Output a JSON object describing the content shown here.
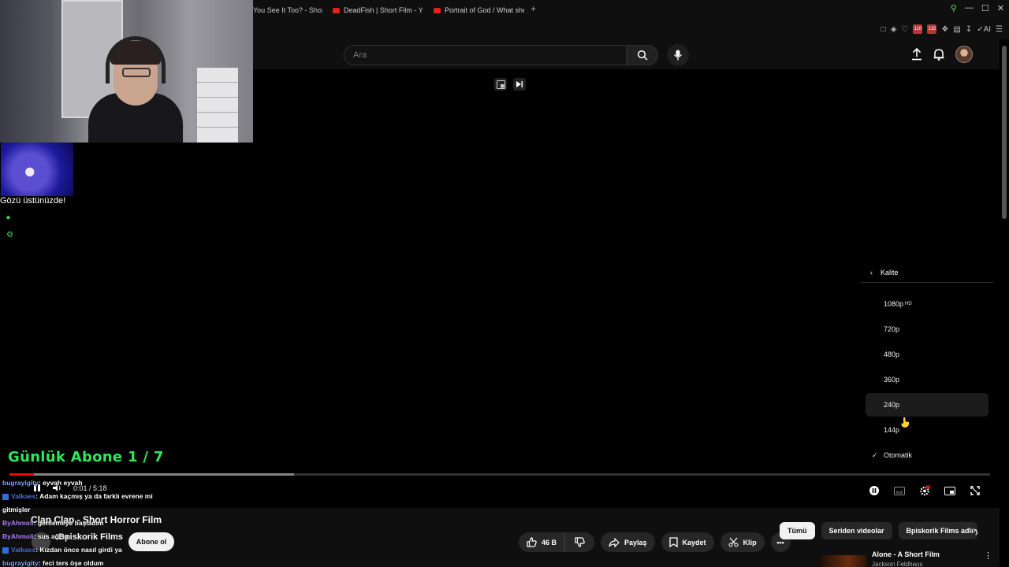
{
  "browser": {
    "tabs": [
      {
        "label": "You See It Too? - Shor"
      },
      {
        "label": "DeadFish | Short Film - Yo"
      },
      {
        "label": "Portrait of God / What she"
      }
    ],
    "toolbar_ai_label": "AI",
    "extension_badges": [
      "110",
      "115"
    ]
  },
  "search": {
    "placeholder": "Ara"
  },
  "overlay": {
    "alert_text": "Gözü üstünüzde!",
    "sub_goal": "Günlük Abone 1 / 7"
  },
  "quality_menu": {
    "title": "Kalite",
    "options": [
      {
        "label": "1080p",
        "badge": "HD"
      },
      {
        "label": "720p"
      },
      {
        "label": "480p"
      },
      {
        "label": "360p"
      },
      {
        "label": "240p"
      },
      {
        "label": "144p"
      },
      {
        "label": "Otomatik"
      }
    ],
    "checked": "Otomatik",
    "highlighted": "240p"
  },
  "player": {
    "time_current": "0:01",
    "time_sep": " / ",
    "time_total": "5:18",
    "progress_played_fraction": 0.0,
    "progress_buffered_fraction": 0.29
  },
  "chat": [
    {
      "user": "bugrayigity",
      "text": ": eyvah eyvah",
      "cls": "u1"
    },
    {
      "user": "Valkaes",
      "text": ": Adam kaçmış ya da farklı evrene mi",
      "cls": "u2",
      "badge": true
    },
    {
      "user": "",
      "text": "gitmişler",
      "cls": ""
    },
    {
      "user": "ByAhmoli",
      "text": ": gerilemeye başladım",
      "cls": "u3"
    },
    {
      "user": "ByAhmoli",
      "text": ": sus ağzım",
      "cls": "u3"
    },
    {
      "user": "Valkaes",
      "text": ": Kızdan önce nasıl girdi ya",
      "cls": "u2",
      "badge": true
    },
    {
      "user": "bugrayigity",
      "text": ": feci ters öşe oldum",
      "cls": "u1"
    }
  ],
  "video": {
    "title": "Clap Clap - Short Horror Film",
    "channel": "Bpiskorik Films",
    "subscribe_label": "Abone ol",
    "likes": "46 B",
    "share_label": "Paylaş",
    "save_label": "Kaydet",
    "clip_label": "Klip"
  },
  "chips": [
    {
      "label": "Tümü",
      "active": true
    },
    {
      "label": "Seriden videolar"
    },
    {
      "label": "Bpiskorik Films adlı y"
    }
  ],
  "recommendation": {
    "title": "Alone - A Short Film",
    "channel": "Jackson Feldhaus"
  },
  "colors": {
    "accent_red": "#ff0000",
    "goal_green": "#2ee85a",
    "background": "#0f0f0f"
  }
}
